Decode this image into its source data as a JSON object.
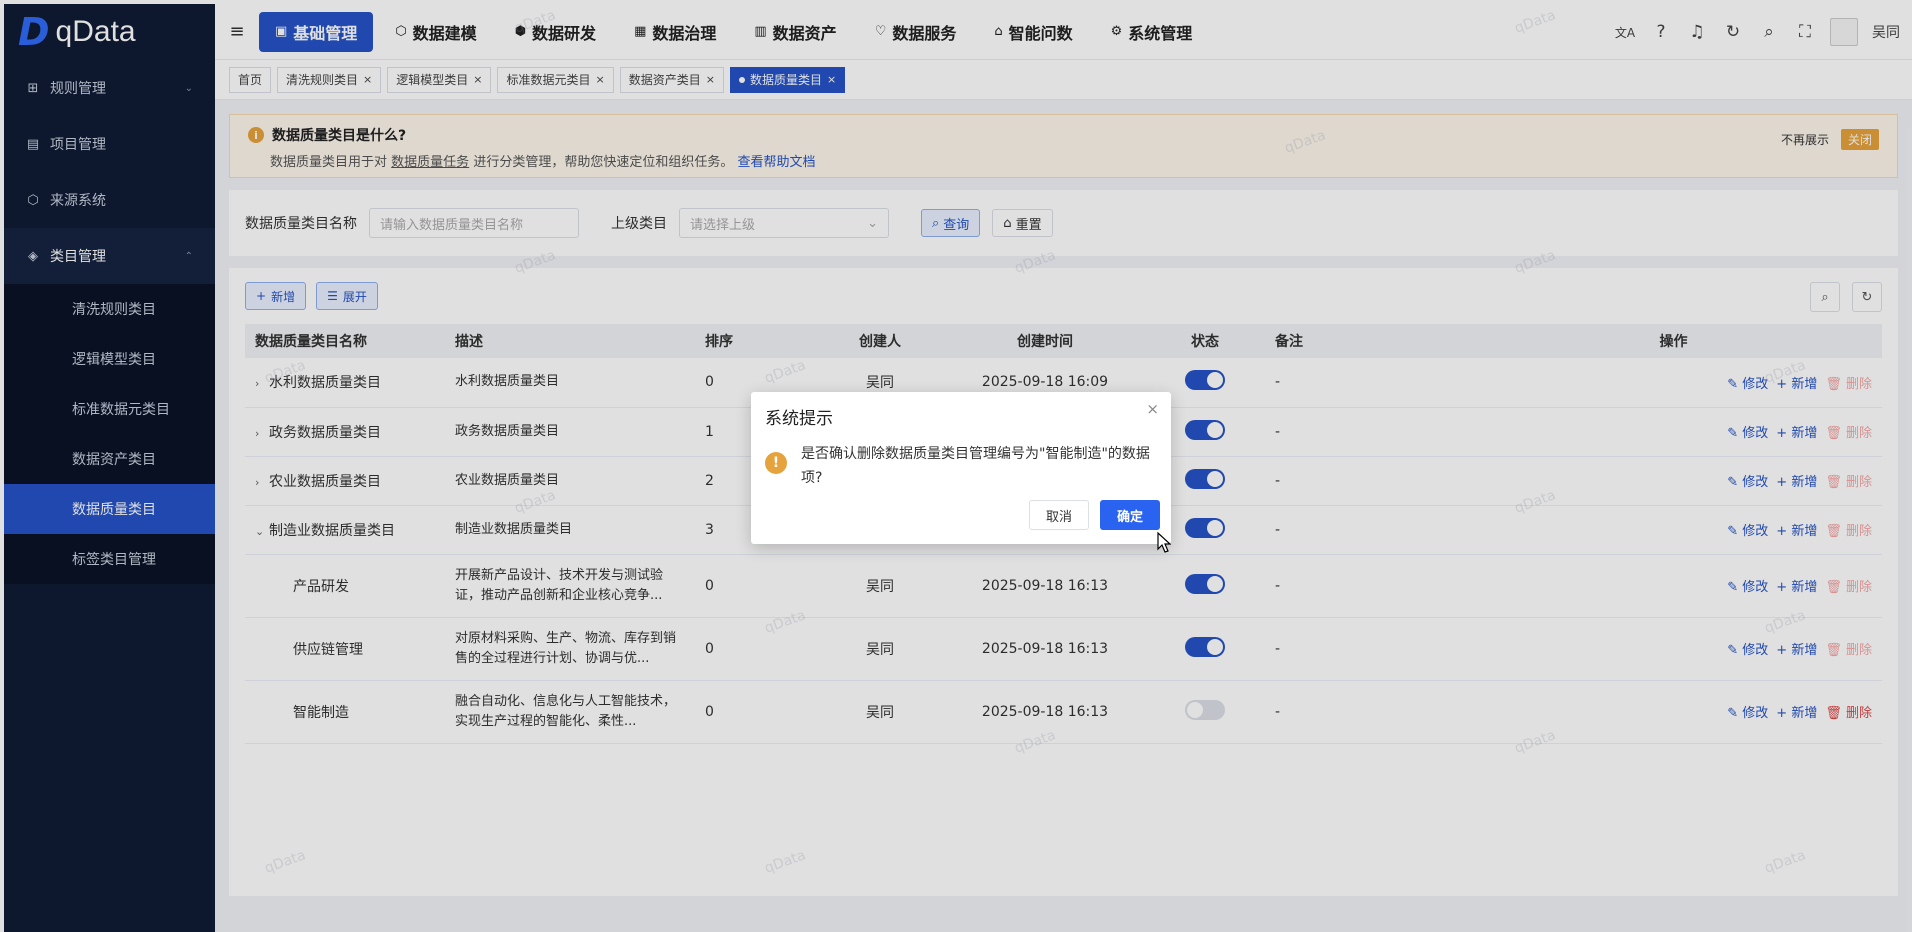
{
  "brand": {
    "mark": "D",
    "name": "qData"
  },
  "sidebar": {
    "items": [
      {
        "icon": "⊞",
        "label": "规则管理",
        "chevron": "⌄"
      },
      {
        "icon": "▤",
        "label": "项目管理"
      },
      {
        "icon": "⬡",
        "label": "来源系统"
      },
      {
        "icon": "◈",
        "label": "类目管理",
        "chevron": "⌃"
      }
    ],
    "subitems": [
      "清洗规则类目",
      "逻辑模型类目",
      "标准数据元类目",
      "数据资产类目",
      "数据质量类目",
      "标签类目管理"
    ]
  },
  "topnav": {
    "menu_icon": "≡",
    "items": [
      {
        "icon": "▣",
        "label": "基础管理"
      },
      {
        "icon": "⬡",
        "label": "数据建模"
      },
      {
        "icon": "⬢",
        "label": "数据研发"
      },
      {
        "icon": "▦",
        "label": "数据治理"
      },
      {
        "icon": "▥",
        "label": "数据资产"
      },
      {
        "icon": "♡",
        "label": "数据服务"
      },
      {
        "icon": "⌂",
        "label": "智能问数"
      },
      {
        "icon": "⚙",
        "label": "系统管理"
      }
    ],
    "icons": {
      "translate": "文A",
      "help": "?",
      "bell": "♫",
      "refresh": "↻",
      "search": "⌕",
      "fullscreen": "⛶"
    },
    "bell_badge": "",
    "user": "吴同"
  },
  "tabs": {
    "items": [
      "首页",
      "清洗规则类目",
      "逻辑模型类目",
      "标准数据元类目",
      "数据资产类目",
      "数据质量类目"
    ],
    "close": "×"
  },
  "notice": {
    "icon": "i",
    "title": "数据质量类目是什么?",
    "desc_prefix": "数据质量类目用于对",
    "desc_link": "数据质量任务",
    "desc_suffix": "进行分类管理，帮助您快速定位和组织任务。",
    "help_link": "查看帮助文档",
    "dont_show": "不再展示",
    "close": "关闭"
  },
  "search": {
    "name_label": "数据质量类目名称",
    "name_placeholder": "请输入数据质量类目名称",
    "parent_label": "上级类目",
    "parent_placeholder": "请选择上级",
    "query": "查询",
    "reset": "重置",
    "icons": {
      "select": "⌄",
      "query": "⌕",
      "reset": "⌂"
    }
  },
  "toolbar": {
    "add": "新增",
    "expand": "展开",
    "icons": {
      "add": "+",
      "expand": "☰",
      "search": "⌕",
      "refresh": "↻"
    }
  },
  "table": {
    "columns": [
      "数据质量类目名称",
      "描述",
      "排序",
      "创建人",
      "创建时间",
      "状态",
      "备注",
      "操作"
    ],
    "rows": [
      {
        "expand": "›",
        "name": "水利数据质量类目",
        "desc": "水利数据质量类目",
        "sort": "0",
        "creator": "吴同",
        "time": "2025-09-18 16:09",
        "enabled": true,
        "remark": "-"
      },
      {
        "expand": "›",
        "name": "政务数据质量类目",
        "desc": "政务数据质量类目",
        "sort": "1",
        "creator": "",
        "time": "",
        "enabled": true,
        "remark": "-"
      },
      {
        "expand": "›",
        "name": "农业数据质量类目",
        "desc": "农业数据质量类目",
        "sort": "2",
        "creator": "",
        "time": "",
        "enabled": true,
        "remark": "-"
      },
      {
        "expand": "⌄",
        "name": "制造业数据质量类目",
        "desc": "制造业数据质量类目",
        "sort": "3",
        "creator": "",
        "time": "",
        "enabled": true,
        "remark": "-"
      },
      {
        "child": true,
        "name": "产品研发",
        "desc": "开展新产品设计、技术开发与测试验证，推动产品创新和企业核心竞争...",
        "sort": "0",
        "creator": "吴同",
        "time": "2025-09-18 16:13",
        "enabled": true,
        "remark": "-"
      },
      {
        "child": true,
        "name": "供应链管理",
        "desc": "对原材料采购、生产、物流、库存到销售的全过程进行计划、协调与优...",
        "sort": "0",
        "creator": "吴同",
        "time": "2025-09-18 16:13",
        "enabled": true,
        "remark": "-"
      },
      {
        "child": true,
        "name": "智能制造",
        "desc": "融合自动化、信息化与人工智能技术，实现生产过程的智能化、柔性...",
        "sort": "0",
        "creator": "吴同",
        "time": "2025-09-18 16:13",
        "enabled": false,
        "remark": "-"
      }
    ],
    "ops": {
      "edit": "修改",
      "add": "新增",
      "delete": "删除",
      "icons": {
        "edit": "✎",
        "add": "+",
        "delete": "🗑"
      }
    }
  },
  "dialog": {
    "title": "系统提示",
    "close": "×",
    "warn": "!",
    "message": "是否确认删除数据质量类目管理编号为\"智能制造\"的数据项?",
    "cancel": "取消",
    "confirm": "确定"
  },
  "watermark": "qData",
  "colors": {
    "primary": "#2553c6",
    "sidebar": "#0f1b34",
    "warning": "#e6a23c",
    "danger": "#e04646"
  }
}
